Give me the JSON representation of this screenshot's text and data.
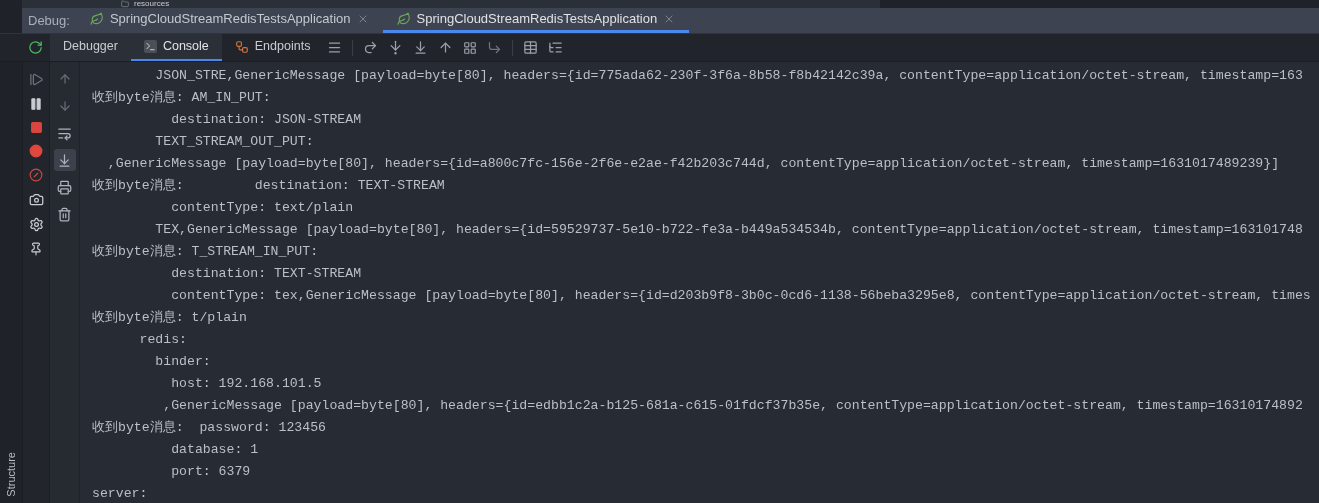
{
  "project_tree": {
    "item": "resources"
  },
  "debug_bar": {
    "label": "Debug:",
    "tabs": [
      {
        "label": "SpringCloudStreamRedisTestsApplication",
        "selected": false
      },
      {
        "label": "SpringCloudStreamRedisTestsApplication",
        "selected": true
      }
    ]
  },
  "toolbar": {
    "tabs": [
      {
        "label": "Debugger",
        "kind": "plain",
        "selected": false
      },
      {
        "label": "Console",
        "kind": "console",
        "selected": true
      },
      {
        "label": "Endpoints",
        "kind": "endpoints",
        "selected": false
      }
    ]
  },
  "console_tools": [
    {
      "kind": "up",
      "selected": false
    },
    {
      "kind": "down",
      "selected": false
    },
    {
      "kind": "wrap",
      "selected": false
    },
    {
      "kind": "scroll-end",
      "selected": true
    },
    {
      "kind": "print",
      "selected": false
    },
    {
      "kind": "clear",
      "selected": false
    }
  ],
  "side_label": "Structure",
  "console_lines": [
    "        JSON_STRE,GenericMessage [payload=byte[80], headers={id=775ada62-230f-3f6a-8b58-f8b42142c39a, contentType=application/octet-stream, timestamp=163",
    "收到byte消息: AM_IN_PUT:",
    "          destination: JSON-STREAM",
    "        TEXT_STREAM_OUT_PUT:",
    "  ,GenericMessage [payload=byte[80], headers={id=a800c7fc-156e-2f6e-e2ae-f42b203c744d, contentType=application/octet-stream, timestamp=1631017489239}]",
    "收到byte消息:         destination: TEXT-STREAM",
    "          contentType: text/plain",
    "        TEX,GenericMessage [payload=byte[80], headers={id=59529737-5e10-b722-fe3a-b449a534534b, contentType=application/octet-stream, timestamp=163101748",
    "收到byte消息: T_STREAM_IN_PUT:",
    "          destination: TEXT-STREAM",
    "          contentType: tex,GenericMessage [payload=byte[80], headers={id=d203b9f8-3b0c-0cd6-1138-56beba3295e8, contentType=application/octet-stream, times",
    "收到byte消息: t/plain",
    "      redis:",
    "        binder:",
    "          host: 192.168.101.5",
    "         ,GenericMessage [payload=byte[80], headers={id=edbb1c2a-b125-681a-c615-01fdcf37b35e, contentType=application/octet-stream, timestamp=16310174892",
    "收到byte消息:  password: 123456",
    "          database: 1",
    "          port: 6379",
    "server:"
  ]
}
